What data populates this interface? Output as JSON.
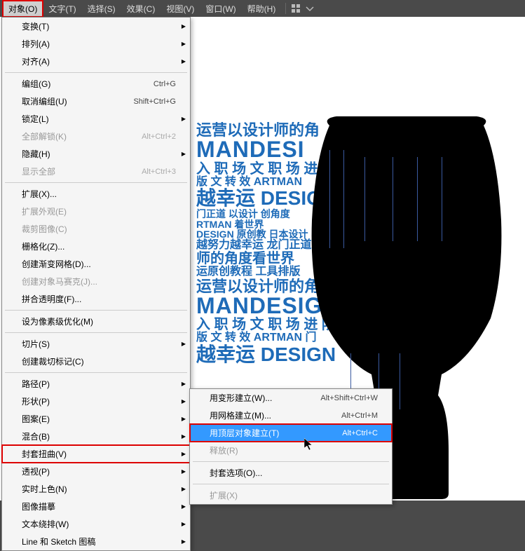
{
  "menubar": {
    "items": [
      {
        "label": "对象(O)",
        "selected": true
      },
      {
        "label": "文字(T)"
      },
      {
        "label": "选择(S)"
      },
      {
        "label": "效果(C)"
      },
      {
        "label": "视图(V)"
      },
      {
        "label": "窗口(W)"
      },
      {
        "label": "帮助(H)"
      }
    ]
  },
  "dropdown": {
    "groups": [
      [
        {
          "label": "变换(T)",
          "sub": true
        },
        {
          "label": "排列(A)",
          "sub": true
        },
        {
          "label": "对齐(A)",
          "sub": true
        }
      ],
      [
        {
          "label": "编组(G)",
          "shortcut": "Ctrl+G"
        },
        {
          "label": "取消编组(U)",
          "shortcut": "Shift+Ctrl+G"
        },
        {
          "label": "锁定(L)",
          "sub": true
        },
        {
          "label": "全部解锁(K)",
          "shortcut": "Alt+Ctrl+2",
          "disabled": true
        },
        {
          "label": "隐藏(H)",
          "sub": true
        },
        {
          "label": "显示全部",
          "shortcut": "Alt+Ctrl+3",
          "disabled": true
        }
      ],
      [
        {
          "label": "扩展(X)..."
        },
        {
          "label": "扩展外观(E)",
          "disabled": true
        },
        {
          "label": "裁剪图像(C)",
          "disabled": true
        },
        {
          "label": "栅格化(Z)..."
        },
        {
          "label": "创建渐变网格(D)..."
        },
        {
          "label": "创建对象马赛克(J)...",
          "disabled": true
        },
        {
          "label": "拼合透明度(F)..."
        }
      ],
      [
        {
          "label": "设为像素级优化(M)"
        }
      ],
      [
        {
          "label": "切片(S)",
          "sub": true
        },
        {
          "label": "创建裁切标记(C)"
        }
      ],
      [
        {
          "label": "路径(P)",
          "sub": true
        },
        {
          "label": "形状(P)",
          "sub": true
        },
        {
          "label": "图案(E)",
          "sub": true
        },
        {
          "label": "混合(B)",
          "sub": true
        },
        {
          "label": "封套扭曲(V)",
          "sub": true,
          "highlight": true
        },
        {
          "label": "透视(P)",
          "sub": true
        },
        {
          "label": "实时上色(N)",
          "sub": true
        },
        {
          "label": "图像描摹",
          "sub": true
        },
        {
          "label": "文本绕排(W)",
          "sub": true
        },
        {
          "label": "Line 和 Sketch 图稿",
          "sub": true
        }
      ]
    ]
  },
  "submenu": {
    "items": [
      {
        "label": "用变形建立(W)...",
        "shortcut": "Alt+Shift+Ctrl+W"
      },
      {
        "label": "用网格建立(M)...",
        "shortcut": "Alt+Ctrl+M"
      },
      {
        "label": "用顶层对象建立(T)",
        "shortcut": "Alt+Ctrl+C",
        "hovered": true
      },
      {
        "label": "释放(R)",
        "disabled": true
      },
      {
        "sep": true
      },
      {
        "label": "封套选项(O)..."
      },
      {
        "sep": true
      },
      {
        "label": "扩展(X)",
        "disabled": true
      }
    ]
  },
  "art": {
    "l1": "运营以设计师的角",
    "l2": "MANDESI",
    "l3": "入 职 场 文 职 场 进 阶",
    "l4": "版 文 转 效 ARTMAN",
    "l5": "越幸运 DESIGN",
    "l6": "门正道 以设计 创角度",
    "l7": "RTMAN 着世界",
    "l8": "DESIGN 原创教  日本设计",
    "l9": "越努力越幸运 龙门正道",
    "l10": "师的角度看世界",
    "l11": "运原创教程 工具排版",
    "l12": "运营以设计师的角",
    "l13": "MANDESIGN",
    "l14": "入 职 场 文 职 场 进 阶 龙",
    "l15": "版 文 转 效 ARTMAN 门",
    "l16": "越幸运 DESIGN"
  }
}
